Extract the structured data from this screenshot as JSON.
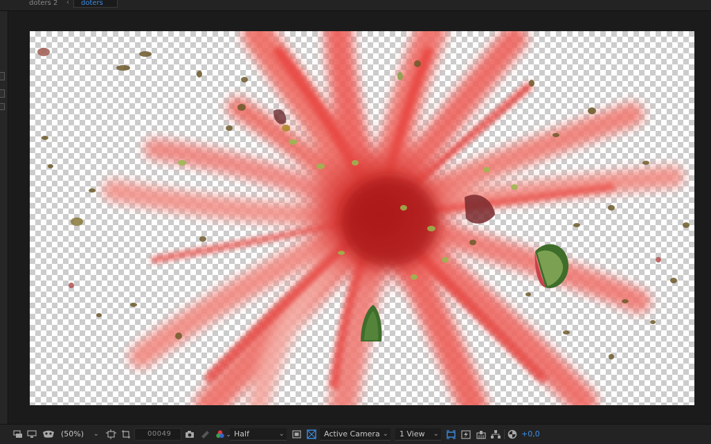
{
  "breadcrumbs": [
    {
      "label": "doters 2",
      "active": false
    },
    {
      "label": "doters",
      "active": true
    }
  ],
  "breadcrumb_separator": "‹",
  "toolbar": {
    "zoom": "(50%)",
    "timecode": "00049",
    "resolution": "Half",
    "camera": "Active Camera",
    "views": "1 View",
    "exposure": "+0,0"
  },
  "colors": {
    "accent": "#3d8fe6",
    "panel": "#232323",
    "viewer_bg": "#1b1b1b",
    "smoke": "#ec4f4a"
  },
  "icons": [
    "always-preview-icon",
    "monitor-icon",
    "mask-view-icon",
    "magnification-icon",
    "region-of-interest-icon",
    "transparency-grid-icon",
    "snapshot-icon",
    "show-snapshot-icon",
    "color-channel-icon",
    "toggle-mask-icon",
    "fast-preview-icon",
    "timeline-icon",
    "flowchart-icon",
    "reset-exposure-icon"
  ]
}
